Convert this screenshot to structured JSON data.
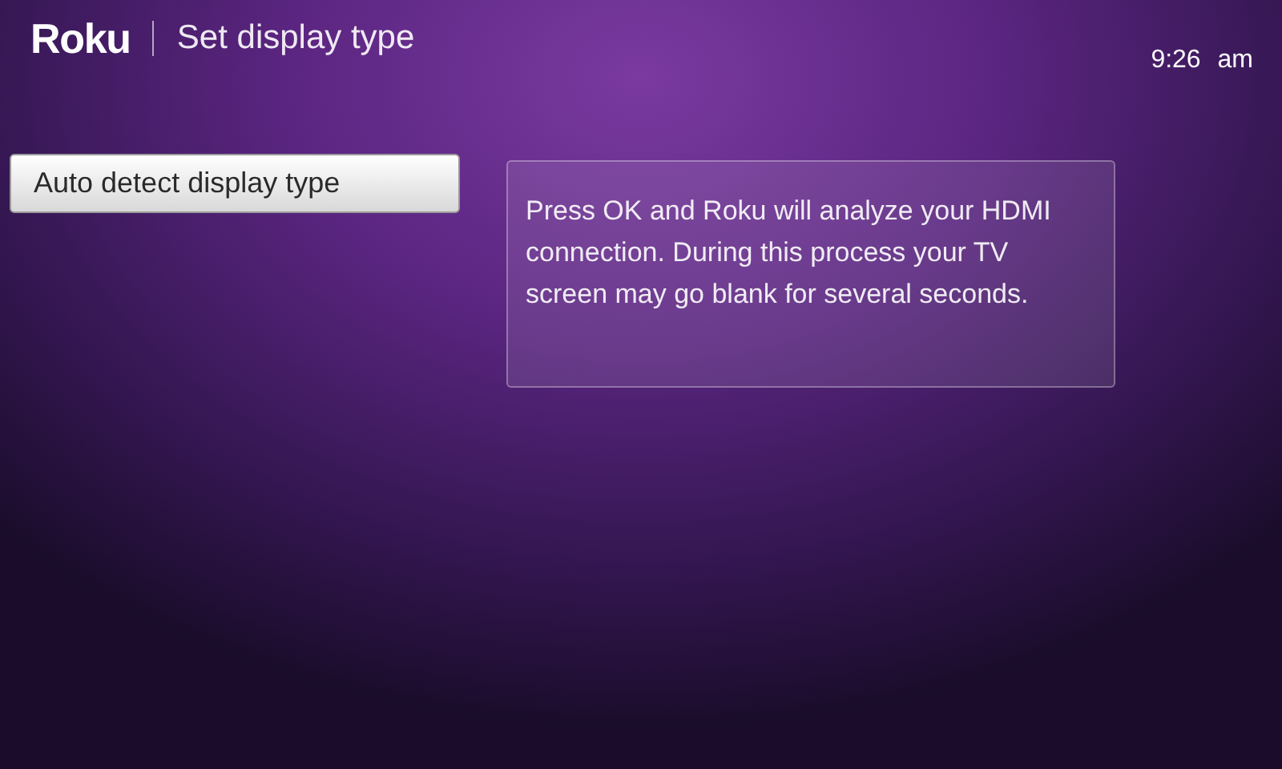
{
  "header": {
    "logo": "Roku",
    "title": "Set display type",
    "time": "9:26 am"
  },
  "menu": [
    {
      "label": "Auto detect display type",
      "selected": true
    }
  ],
  "info_panel": {
    "text": "Press OK and Roku will analyze your HDMI connection. During this process your TV screen may go blank for several seconds."
  }
}
